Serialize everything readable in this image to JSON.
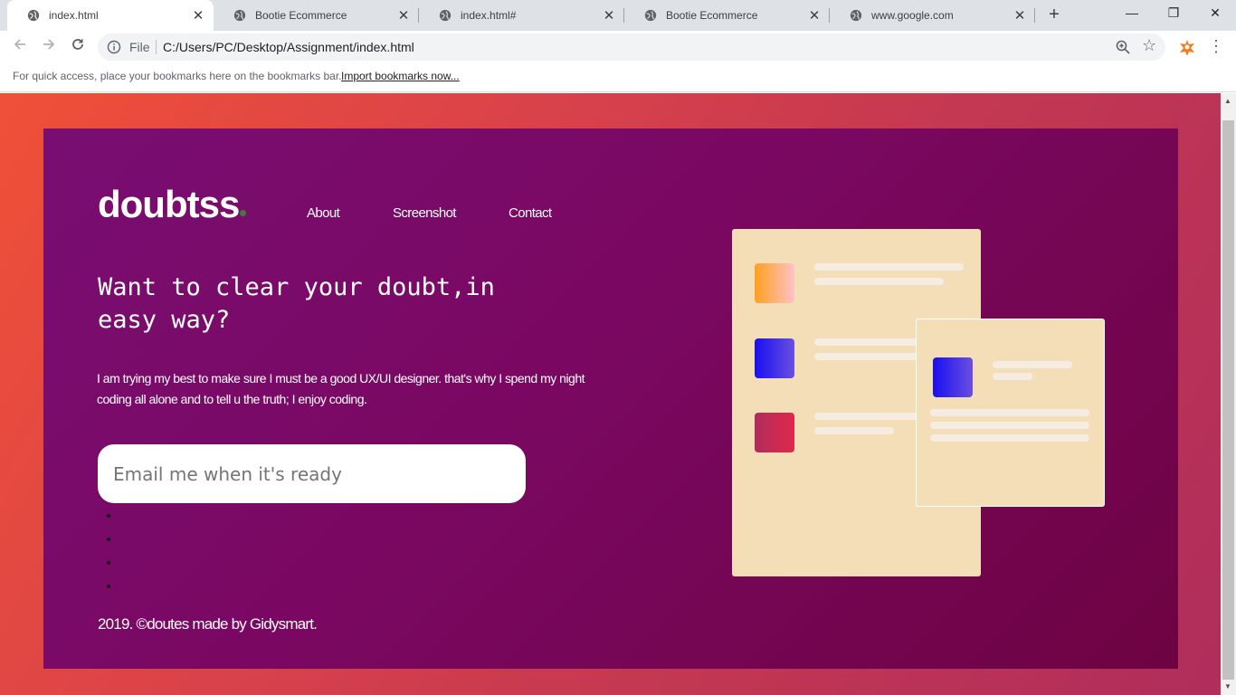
{
  "browser": {
    "tabs": [
      {
        "title": "index.html",
        "active": true
      },
      {
        "title": "Bootie Ecommerce",
        "active": false
      },
      {
        "title": "index.html#",
        "active": false
      },
      {
        "title": "Bootie Ecommerce",
        "active": false
      },
      {
        "title": "www.google.com",
        "active": false
      }
    ],
    "new_tab": "+",
    "window_controls": {
      "minimize": "—",
      "maximize": "❐",
      "close": "✕"
    },
    "address": {
      "scheme_label": "File",
      "url": "C:/Users/PC/Desktop/Assignment/index.html"
    },
    "bookmarks_bar": {
      "text": "For quick access, place your bookmarks here on the bookmarks bar.",
      "link": "Import bookmarks now..."
    }
  },
  "page": {
    "logo": "doubtss",
    "nav": [
      "About",
      "Screenshot",
      "Contact"
    ],
    "headline": "Want to clear your doubt,in easy way?",
    "paragraph": "I am trying my best to make sure I must be a good UX/UI designer. that's why I spend my night coding all alone and to tell u the truth; I enjoy coding.",
    "email_placeholder": "Email me when it's ready",
    "bullet_count": 4,
    "footer": "2019. ©doutes made by Gidysmart.",
    "colors": {
      "outer_bg": "#e14446",
      "card_bg": "#780a68",
      "illustration_paper": "#f3deb7",
      "square_orange": "#ffa01f",
      "square_blue": "#1a0ff0",
      "square_red": "#e0284a"
    }
  }
}
